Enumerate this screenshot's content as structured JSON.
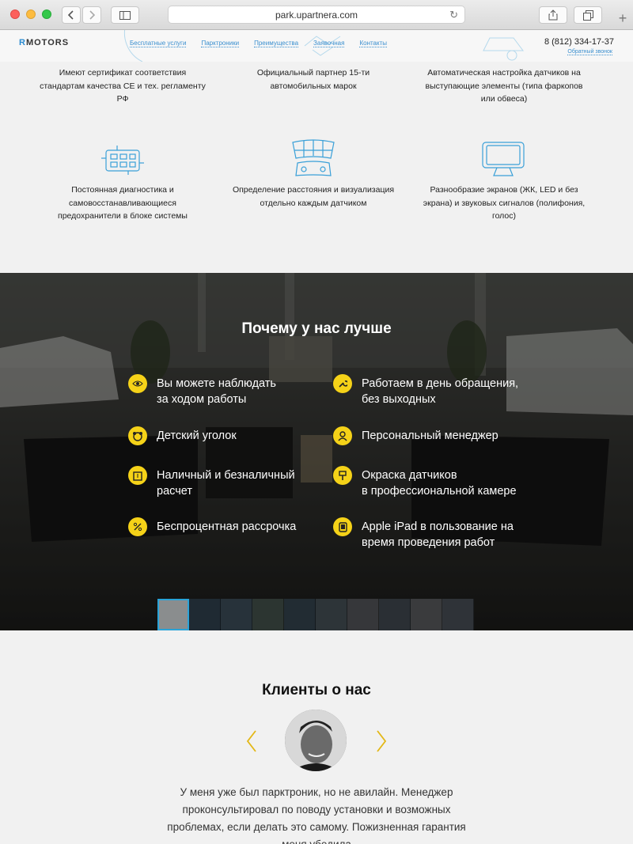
{
  "browser": {
    "url": "park.upartnera.com"
  },
  "header": {
    "logo_r": "R",
    "logo_text": "MOTORS",
    "nav": [
      "Бесплатные услуги",
      "Парктроники",
      "Преимущества",
      "Заявочная",
      "Контакты"
    ],
    "phone": "8 (812) 334-17-37",
    "callback": "Обратный звонок"
  },
  "features": {
    "items": [
      {
        "text": "Имеют сертификат соответствия стандартам качества CE и тех. регламенту РФ",
        "icon": "certificate-icon"
      },
      {
        "text": "Официальный партнер 15-ти автомобильных марок",
        "icon": "handshake-icon"
      },
      {
        "text": "Автоматическая настройка датчиков на выступающие элементы (типа фаркопов или обвеса)",
        "icon": "car-icon"
      },
      {
        "text": "Постоянная диагностика и самовосстанавливающиеся предохранители в блоке системы",
        "icon": "circuit-board-icon"
      },
      {
        "text": "Определение расстояния и визуализация отдельно каждым датчиком",
        "icon": "sensor-grid-icon"
      },
      {
        "text": "Разнообразие экранов (ЖК, LED и без экрана) и звуковых сигналов (полифония, голос)",
        "icon": "monitor-icon"
      }
    ]
  },
  "why": {
    "title": "Почему у нас лучше",
    "items": [
      {
        "text": "Вы можете наблюдать\nза ходом работы",
        "icon": "eye-icon"
      },
      {
        "text": "Работаем в день обращения,\nбез выходных",
        "icon": "wrench-icon"
      },
      {
        "text": "Детский уголок",
        "icon": "teddy-bear-icon"
      },
      {
        "text": "Персональный менеджер",
        "icon": "manager-icon"
      },
      {
        "text": "Наличный и безналичный\nрасчет",
        "icon": "wallet-icon"
      },
      {
        "text": "Окраска датчиков\nв профессиональной камере",
        "icon": "paint-icon"
      },
      {
        "text": "Беспроцентная рассрочка",
        "icon": "percent-icon"
      },
      {
        "text": "Apple iPad в пользование на\nвремя проведения работ",
        "icon": "tablet-icon"
      }
    ],
    "thumbnails_count": 10,
    "accent": "#f5d218"
  },
  "clients": {
    "title": "Клиенты о нас",
    "review": "У меня уже был парктроник, но не авилайн. Менеджер проконсультировал по поводу установки и возможных проблемах, если делать это самому. Пожизненная гарантия меня убедила"
  },
  "colors": {
    "link": "#3a8fcf",
    "icon_blue": "#3aa0d8",
    "accent_yellow": "#f5d218"
  }
}
